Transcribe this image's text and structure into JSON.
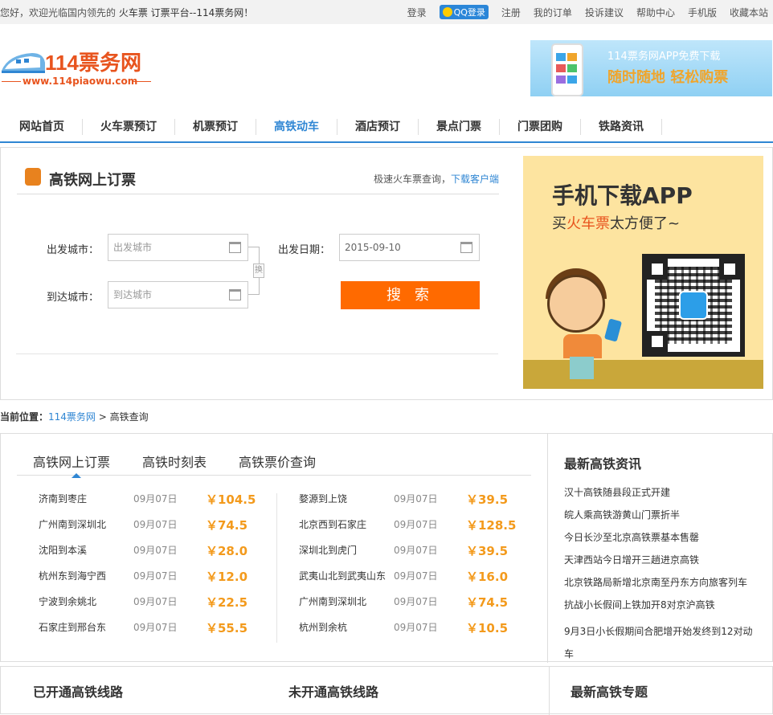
{
  "topbar": {
    "welcome_prefix": "您好，欢迎光临国内领先的",
    "welcome_highlight": "火车票 订票平台--114票务网！",
    "login": "登录",
    "qq_login": "QQ登录",
    "register": "注册",
    "my_orders": "我的订单",
    "complaints": "投诉建议",
    "help": "帮助中心",
    "mobile": "手机版",
    "bookmark": "收藏本站"
  },
  "logo": {
    "name": "114票务网",
    "url": "www.114piaowu.com"
  },
  "app_banner": {
    "line1": "114票务网APP免费下载",
    "line2": "随时随地  轻松购票"
  },
  "nav": {
    "items": [
      "网站首页",
      "火车票预订",
      "机票预订",
      "高铁动车",
      "酒店预订",
      "景点门票",
      "门票团购",
      "铁路资讯"
    ],
    "active_index": 3
  },
  "search": {
    "title": "高铁网上订票",
    "right_text": "极速火车票查询，",
    "right_link": "下载客户端",
    "from_label": "出发城市：",
    "from_placeholder": "出发城市",
    "to_label": "到达城市：",
    "to_placeholder": "到达城市",
    "date_label": "出发日期：",
    "date_value": "2015-09-10",
    "swap": "换",
    "button": "搜 索"
  },
  "ad": {
    "title": "手机下载APP",
    "sub_prefix": "买",
    "sub_highlight": "火车票",
    "sub_suffix": "太方便了~"
  },
  "breadcrumb": {
    "label": "当前位置：",
    "home": "114票务网",
    "sep": ">",
    "current": "高铁查询"
  },
  "tabs": [
    "高铁网上订票",
    "高铁时刻表",
    "高铁票价查询"
  ],
  "tickets_left": [
    {
      "route": "济南到枣庄",
      "date": "09月07日",
      "price": "￥104.5"
    },
    {
      "route": "广州南到深圳北",
      "date": "09月07日",
      "price": "￥74.5"
    },
    {
      "route": "沈阳到本溪",
      "date": "09月07日",
      "price": "￥28.0"
    },
    {
      "route": "杭州东到海宁西",
      "date": "09月07日",
      "price": "￥12.0"
    },
    {
      "route": "宁波到余姚北",
      "date": "09月07日",
      "price": "￥22.5"
    },
    {
      "route": "石家庄到邢台东",
      "date": "09月07日",
      "price": "￥55.5"
    }
  ],
  "tickets_right": [
    {
      "route": "婺源到上饶",
      "date": "09月07日",
      "price": "￥39.5"
    },
    {
      "route": "北京西到石家庄",
      "date": "09月07日",
      "price": "￥128.5"
    },
    {
      "route": "深圳北到虎门",
      "date": "09月07日",
      "price": "￥39.5"
    },
    {
      "route": "武夷山北到武夷山东",
      "date": "09月07日",
      "price": "￥16.0"
    },
    {
      "route": "广州南到深圳北",
      "date": "09月07日",
      "price": "￥74.5"
    },
    {
      "route": "杭州到余杭",
      "date": "09月07日",
      "price": "￥10.5"
    }
  ],
  "news": {
    "title": "最新高铁资讯",
    "items": [
      "汉十高铁随县段正式开建",
      "皖人乘高铁游黄山门票折半",
      "今日长沙至北京高铁票基本售罄",
      "天津西站今日增开三趟进京高铁",
      "北京铁路局新增北京南至丹东方向旅客列车",
      "抗战小长假间上铁加开8对京沪高铁",
      "9月3日小长假期间合肥增开始发终到12对动车"
    ]
  },
  "bottom": {
    "opened": "已开通高铁线路",
    "unopened": "未开通高铁线路",
    "topics": "最新高铁专题"
  },
  "colors": {
    "brand_orange": "#e8541e",
    "nav_blue": "#2f86d3",
    "price_orange": "#f39a1c",
    "search_button": "#ff6a00"
  }
}
